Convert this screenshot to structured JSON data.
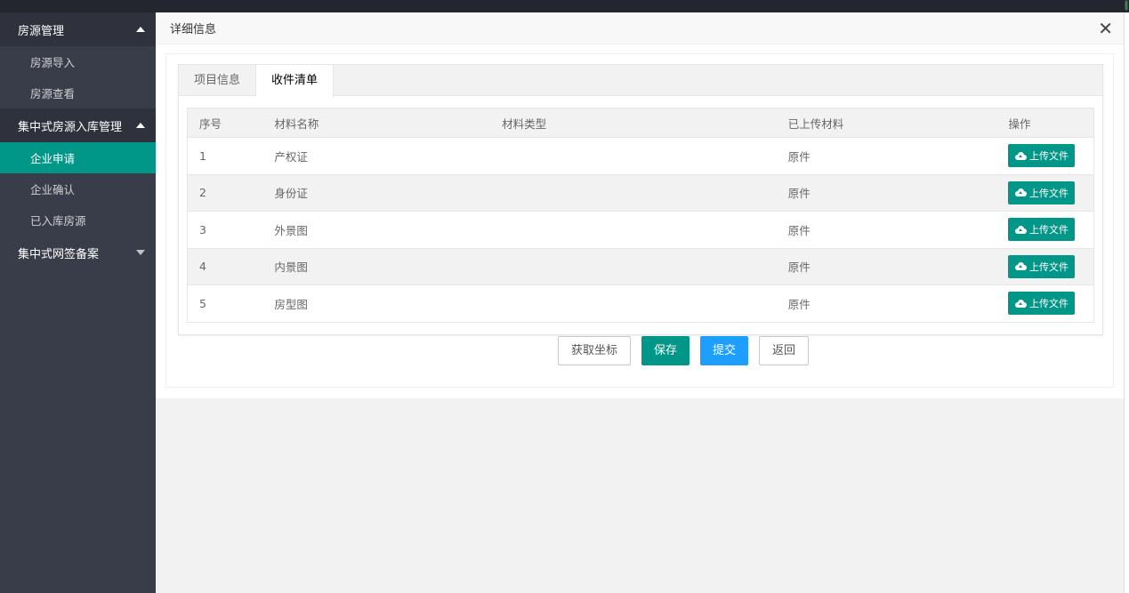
{
  "sidebar": {
    "groups": [
      {
        "label": "房源管理",
        "expanded": true,
        "items": [
          {
            "label": "房源导入"
          },
          {
            "label": "房源查看"
          }
        ]
      },
      {
        "label": "集中式房源入库管理",
        "expanded": true,
        "items": [
          {
            "label": "企业申请"
          },
          {
            "label": "企业确认"
          },
          {
            "label": "已入库房源"
          }
        ]
      },
      {
        "label": "集中式网签备案",
        "expanded": false
      }
    ],
    "active_item": "企业申请"
  },
  "dialog": {
    "title": "详细信息",
    "close_icon": "close-icon"
  },
  "tabs": [
    {
      "label": "项目信息",
      "active": false
    },
    {
      "label": "收件清单",
      "active": true
    }
  ],
  "table": {
    "headers": [
      "序号",
      "材料名称",
      "材料类型",
      "已上传材料",
      "操作"
    ],
    "rows": [
      {
        "index": "1",
        "name": "产权证",
        "type": "",
        "uploaded": "原件",
        "action": "上传文件"
      },
      {
        "index": "2",
        "name": "身份证",
        "type": "",
        "uploaded": "原件",
        "action": "上传文件"
      },
      {
        "index": "3",
        "name": "外景图",
        "type": "",
        "uploaded": "原件",
        "action": "上传文件"
      },
      {
        "index": "4",
        "name": "内景图",
        "type": "",
        "uploaded": "原件",
        "action": "上传文件"
      },
      {
        "index": "5",
        "name": "房型图",
        "type": "",
        "uploaded": "原件",
        "action": "上传文件"
      }
    ]
  },
  "actions": {
    "get_coords": "获取坐标",
    "save": "保存",
    "submit": "提交",
    "back": "返回"
  },
  "colors": {
    "sidebar_bg": "#393d49",
    "accent": "#009688",
    "blue": "#1e9fff"
  }
}
